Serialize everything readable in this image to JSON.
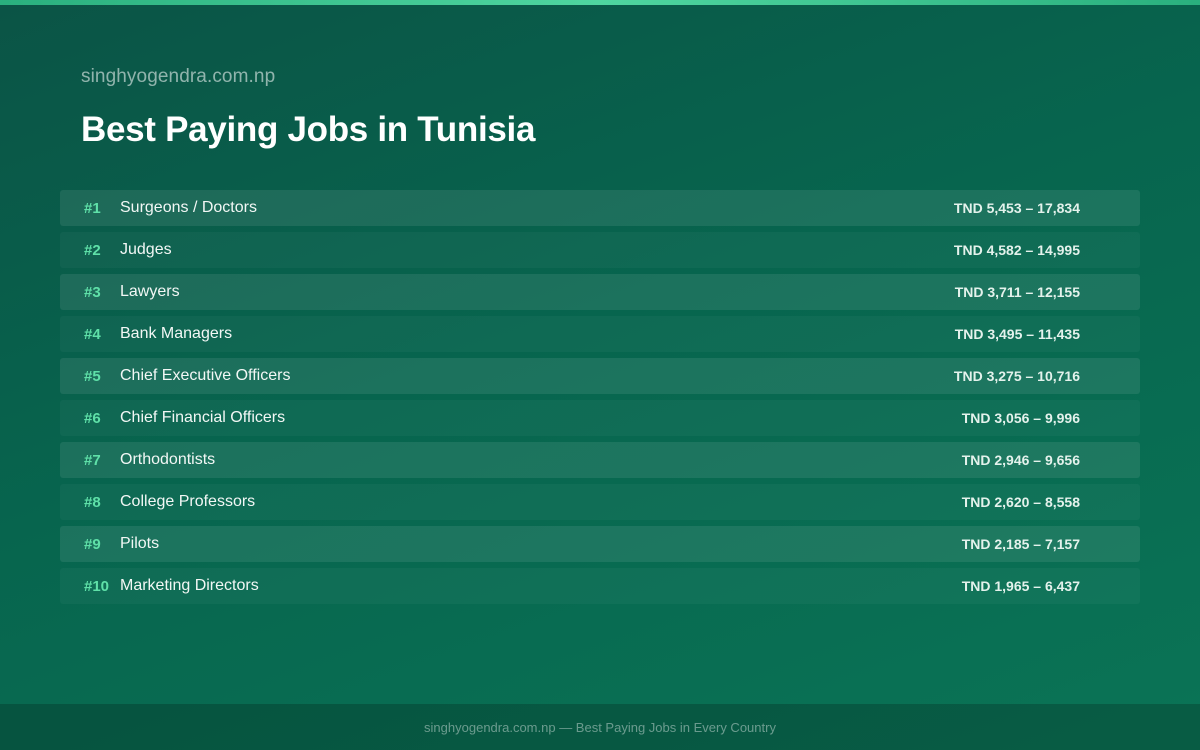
{
  "header": {
    "site_name": "singhyogendra.com.np",
    "title": "Best Paying Jobs in Tunisia"
  },
  "jobs": [
    {
      "rank": "#1",
      "title": "Surgeons / Doctors",
      "salary": "TND 5,453 – 17,834"
    },
    {
      "rank": "#2",
      "title": "Judges",
      "salary": "TND 4,582 – 14,995"
    },
    {
      "rank": "#3",
      "title": "Lawyers",
      "salary": "TND 3,711 – 12,155"
    },
    {
      "rank": "#4",
      "title": "Bank Managers",
      "salary": "TND 3,495 – 11,435"
    },
    {
      "rank": "#5",
      "title": "Chief Executive Officers",
      "salary": "TND 3,275 – 10,716"
    },
    {
      "rank": "#6",
      "title": "Chief Financial Officers",
      "salary": "TND 3,056 – 9,996"
    },
    {
      "rank": "#7",
      "title": "Orthodontists",
      "salary": "TND 2,946 – 9,656"
    },
    {
      "rank": "#8",
      "title": "College Professors",
      "salary": "TND 2,620 – 8,558"
    },
    {
      "rank": "#9",
      "title": "Pilots",
      "salary": "TND 2,185 – 7,157"
    },
    {
      "rank": "#10",
      "title": "Marketing Directors",
      "salary": "TND 1,965 – 6,437"
    }
  ],
  "footer": {
    "text": "singhyogendra.com.np — Best Paying Jobs in Every Country"
  },
  "colors": {
    "background": "#07654e",
    "accent": "#5fe0a8",
    "top_bar": "#4fd6a0"
  }
}
